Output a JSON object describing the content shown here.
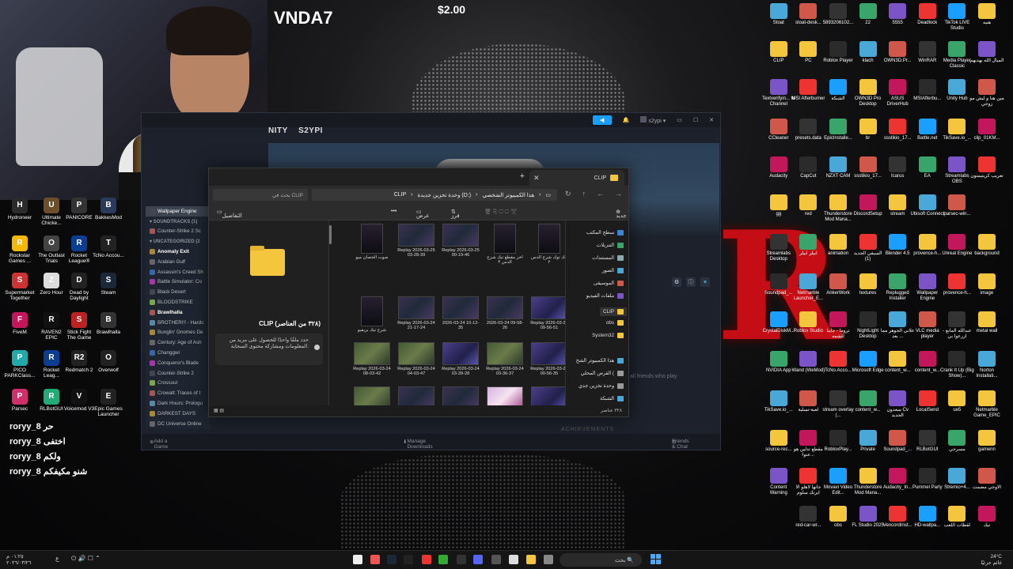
{
  "stream": {
    "streamer": "VNDA7",
    "donation": "$2.00"
  },
  "chat": [
    {
      "user": "roryy_8",
      "msg": "حر"
    },
    {
      "user": "roryy_8",
      "msg": "اختفى"
    },
    {
      "user": "roryy_8",
      "msg": "ولكم"
    },
    {
      "user": "roryy_8",
      "msg": "شنو مكيفكم"
    }
  ],
  "left_icons": [
    {
      "label": "Hydroneer",
      "color": "#2b2b2b",
      "glyph": "H"
    },
    {
      "label": "Ultimate Chicke...",
      "color": "#6b4f2a",
      "glyph": "U"
    },
    {
      "label": "PANICORE",
      "color": "#333",
      "glyph": "P"
    },
    {
      "label": "BakkesMod",
      "color": "#2a3a5a",
      "glyph": "B"
    },
    {
      "label": "Rockstar Games ...",
      "color": "#f5b800",
      "glyph": "R"
    },
    {
      "label": "The Outlast Trials",
      "color": "#444",
      "glyph": "O"
    },
    {
      "label": "Rocket League®",
      "color": "#0b3d91",
      "glyph": "R"
    },
    {
      "label": "TcNo Accou...",
      "color": "#222",
      "glyph": "T"
    },
    {
      "label": "Supermarket Together",
      "color": "#c33",
      "glyph": "S"
    },
    {
      "label": "Zero Hour",
      "color": "#ddd",
      "glyph": "Z"
    },
    {
      "label": "Dead by Daylight",
      "color": "#222",
      "glyph": "D"
    },
    {
      "label": "Steam",
      "color": "#1b2838",
      "glyph": "S"
    },
    {
      "label": "FiveM",
      "color": "#c2185b",
      "glyph": "F"
    },
    {
      "label": "RAVEN2 EPIC",
      "color": "#111",
      "glyph": "R"
    },
    {
      "label": "Stick Fight The Game",
      "color": "#b22",
      "glyph": "S"
    },
    {
      "label": "Brawlhalla",
      "color": "#333",
      "glyph": "B"
    },
    {
      "label": "PICO PARKClass...",
      "color": "#2aa",
      "glyph": "P"
    },
    {
      "label": "Rocket Leag...",
      "color": "#0b3d91",
      "glyph": "R"
    },
    {
      "label": "Redmatch 2",
      "color": "#222",
      "glyph": "R2"
    },
    {
      "label": "Overwolf",
      "color": "#222",
      "glyph": "O"
    },
    {
      "label": "Parsec",
      "color": "#d12f6b",
      "glyph": "P"
    },
    {
      "label": "RLBotGUI",
      "color": "#2a7",
      "glyph": "R"
    },
    {
      "label": "Voicemod V3",
      "color": "#111",
      "glyph": "V"
    },
    {
      "label": "Epic Games Launcher",
      "color": "#222",
      "glyph": "E"
    }
  ],
  "steam": {
    "nav": [
      "NITY",
      "S2YPI"
    ],
    "user": "s2ypi",
    "library_items": [
      {
        "label": "Wallpaper Engine",
        "type": "sel"
      },
      {
        "label": "SOUNDTRACKS (1)",
        "type": "hdr"
      },
      {
        "label": "Counter-Strike 2 Sc",
        "type": "item"
      },
      {
        "label": "UNCATEGORIZED (2",
        "type": "hdr"
      },
      {
        "label": "Anomaly Exit",
        "type": "bold"
      },
      {
        "label": "Arabian Gulf",
        "type": "item"
      },
      {
        "label": "Assassin's Creed Sh",
        "type": "item"
      },
      {
        "label": "Battle Simulator: Co",
        "type": "item"
      },
      {
        "label": "Black Desert",
        "type": "item"
      },
      {
        "label": "BLOODSTRIKE",
        "type": "item"
      },
      {
        "label": "Brawlhalla",
        "type": "bold"
      },
      {
        "label": "BROTHER!!! - Hardc",
        "type": "item"
      },
      {
        "label": "Bunglin' Gnomes De",
        "type": "item"
      },
      {
        "label": "Century: Age of Ash",
        "type": "item"
      },
      {
        "label": "Changgwi",
        "type": "item"
      },
      {
        "label": "Conqueror's Blade",
        "type": "item"
      },
      {
        "label": "Counter-Strike 2",
        "type": "item"
      },
      {
        "label": "Crossout",
        "type": "item"
      },
      {
        "label": "Crowalt: Traces of t",
        "type": "item"
      },
      {
        "label": "Dark Hours: Prologu",
        "type": "item"
      },
      {
        "label": "DARKEST DAYS",
        "type": "item"
      },
      {
        "label": "DC Universe Online",
        "type": "item"
      }
    ],
    "bottom": {
      "add_game": "Add a Game",
      "downloads": "Manage Downloads",
      "friends": "Friends & Chat"
    },
    "view_friends": "View all friends who play",
    "achievements": "ACHIEVEMENTS"
  },
  "explorer": {
    "tab_title": "CLIP",
    "new_tab": "+",
    "search_placeholder": "بحث في CLIP",
    "breadcrumb": [
      "هذا الكمبيوتر الشخصي",
      "وحدة تخزين جديدة (D:)",
      "CLIP"
    ],
    "toolbar": {
      "new": "جديد",
      "sort": "فرز",
      "view": "عرض",
      "details": "التفاصيل"
    },
    "details_title": "CLIP (٣٢٨ من العناصر)",
    "details_info": "حدد ملفًا واحدًا للحصول على مزيد من المعلومات ومشاركة محتوى السحابة.",
    "tiles": [
      {
        "label": "تيك توك شرح الدس ٢",
        "kind": "tall"
      },
      {
        "label": "اخر مقطع تيك شرح الدس ٣",
        "kind": "tall"
      },
      {
        "label": "Replay 2026-03-25 00-19-46",
        "kind": "dark"
      },
      {
        "label": "Replay 2026-03-25 03-28-39",
        "kind": "dark"
      },
      {
        "label": "صوت الحصان ميو",
        "kind": "tall"
      },
      {
        "label": "Replay 2026-03-24 09-56-51",
        "kind": "purple"
      },
      {
        "label": "2026-03-24 09-58-26",
        "kind": "dark"
      },
      {
        "label": "2026-03-24 10-12-35",
        "kind": "dark"
      },
      {
        "label": "Replay 2026-03-24 21-17-24",
        "kind": "dark"
      },
      {
        "label": "شرح تيك بريفيو",
        "kind": "tall"
      },
      {
        "label": "Replay 2026-03-24 00-56-35",
        "kind": "purple"
      },
      {
        "label": "Replay 2026-03-24 03-36-37",
        "kind": "green"
      },
      {
        "label": "Replay 2026-03-24 03-39-28",
        "kind": "purple"
      },
      {
        "label": "Replay 2026-03-24 04-03-47",
        "kind": "green"
      },
      {
        "label": "Replay 2026-03-24 08-03-42",
        "kind": "green"
      },
      {
        "label": "",
        "kind": "purple"
      },
      {
        "label": "",
        "kind": "pink"
      },
      {
        "label": "",
        "kind": "dark"
      },
      {
        "label": "",
        "kind": "dark"
      },
      {
        "label": "",
        "kind": "green"
      }
    ],
    "nav_items": [
      {
        "label": "سطح المكتب",
        "color": "#3a86d4"
      },
      {
        "label": "التنزيلات",
        "color": "#3aa56b"
      },
      {
        "label": "المستندات",
        "color": "#8aa"
      },
      {
        "label": "الصور",
        "color": "#4aa8d8"
      },
      {
        "label": "الموسيقى",
        "color": "#d0584b"
      },
      {
        "label": "ملفات الفيديو",
        "color": "#7b55c7"
      },
      {
        "label": "CLIP",
        "color": "#f3c63d"
      },
      {
        "label": "obs",
        "color": "#f3c63d"
      },
      {
        "label": "System32",
        "color": "#f3c63d"
      },
      {
        "label": "هذا الكمبيوتر الشخ",
        "color": "#4aa8d8"
      },
      {
        "label": "القرص المحلي (",
        "color": "#999"
      },
      {
        "label": "وحدة تخزين جدي",
        "color": "#999"
      },
      {
        "label": "الشبكة",
        "color": "#4aa8d8"
      }
    ],
    "status": "٣٢٨ عناصر"
  },
  "right_icons": [
    [
      "هنيه",
      "TikTok LIVE Studio",
      "Deadlock",
      "5555",
      "22",
      "5893206102...",
      "stoat-desk...",
      "Stoat"
    ],
    [
      "الميال الله يهديهم",
      "Media Player Classic",
      "WinRAR",
      "OWN3D.Pr...",
      "klach",
      "Roblox Player",
      "PC",
      "CLIP"
    ],
    [
      "مين هنا و ليش مو زوجي",
      "Unity Hub",
      "MSIAfterbu...",
      "ASUS DriverHub",
      "OWN3D Pro Desktop",
      "الشبكة",
      "MSI Afterburner",
      "Textverifyin... to Channel"
    ],
    [
      "clip_01KM...",
      "TikSave.io_...",
      "Battle.net",
      "ssstikio_17...",
      "br",
      "EpicInstalle...",
      "presets.data",
      "CCleaner"
    ],
    [
      "تعريب كريتيمتون",
      "Streamlabs OBS",
      "EA",
      "Icarus",
      "ssstikio_17...",
      "NZXT CAM",
      "CapCut",
      "Audacity"
    ],
    [
      "",
      "parsec-win...",
      "Ubisoft Connect",
      "stream",
      "DiscordSetup",
      "Thunderstore Mod Mana...",
      "red",
      "gg"
    ],
    [
      "background",
      "Unreal Engine",
      "provence-h...",
      "Blender 4.5",
      "السيفي الجديد (1)",
      "animation",
      "ابيلر ابيلر",
      "Streamlabs Desktop"
    ],
    [
      "image",
      "provence-h...",
      "Wallpaper Engine",
      "Replugged Installer",
      "textures",
      "AnkerWork",
      "Netmarble Launcher_E...",
      "Soundpad_..."
    ],
    [
      "metal wall",
      "عبدالله المانع - ازرعوا بي",
      "VLC media player",
      "علاني الجوهر مما بعد ...",
      "NightLight Desktop",
      "تروما - جاينا للشمه",
      "Roblox Studio",
      "CrystalDiskM..."
    ],
    [
      "Norton Installati...",
      "Crank It Up (Big Show)...",
      "content_w...",
      "content_w...",
      "Microsoft Edge",
      "TcNo.Acco...",
      "Wand (WeMod)",
      "NVIDIA App"
    ],
    [
      "Netmarble Game_EPIC",
      "ue5",
      "LocalSend",
      "سعدون Cv الجديد",
      "content_w...",
      "stream overlay (...",
      "لعبة-تسلية",
      "TikSave.io_..."
    ],
    [
      "gamenn",
      "مسرحي",
      "RLBotGUI",
      "Soundpad_...",
      "Private",
      "RobloxPlay...",
      "مقطع تدلين هو عنوا...",
      "source-rec..."
    ],
    [
      "الاوجي مضمت",
      "Stremio+4...",
      "Pummel Party",
      "Audacity_In...",
      "Thunderstore Mod Mana...",
      "Movavi Video Edit...",
      "جانها لاهلو الا ايرتك سلوم",
      "Content Warning"
    ],
    [
      "تيك",
      "لقطات اللعب",
      "HD-wallpa...",
      "VencordInst...",
      "FL Studio 2025",
      "obs",
      "red-car-wr..."
    ]
  ],
  "taskbar": {
    "search": "بحث",
    "clock": [
      "٠١:٢٥ م",
      "٢٠٢٦/٠٣/٢٦"
    ],
    "weather": [
      "24°C",
      "غائم جزئيًا"
    ]
  }
}
